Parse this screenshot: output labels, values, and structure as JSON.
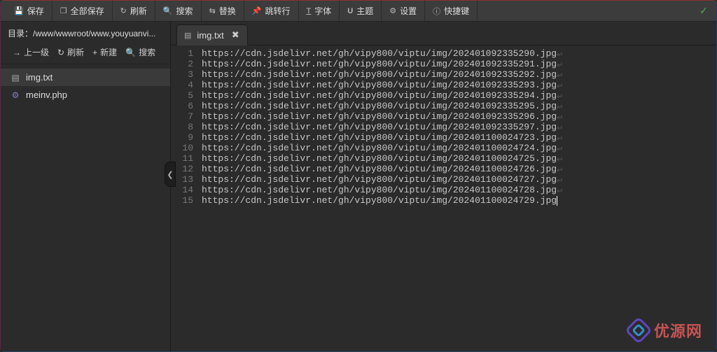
{
  "toolbar": {
    "save": "保存",
    "save_all": "全部保存",
    "refresh": "刷新",
    "search": "搜索",
    "replace": "替换",
    "goto": "跳转行",
    "font": "字体",
    "theme": "主题",
    "settings": "设置",
    "shortcuts": "快捷键"
  },
  "sidebar": {
    "dir_label": "目录：",
    "dir_path": "/www/wwwroot/www.youyuanvi...",
    "up": "上一级",
    "refresh": "刷新",
    "new": "新建",
    "search": "搜索",
    "files": [
      {
        "name": "img.txt",
        "type": "txt",
        "active": true
      },
      {
        "name": "meinv.php",
        "type": "php",
        "active": false
      }
    ]
  },
  "tab": {
    "name": "img.txt"
  },
  "editor": {
    "lines": [
      "https://cdn.jsdelivr.net/gh/vipy800/viptu/img/202401092335290.jpg",
      "https://cdn.jsdelivr.net/gh/vipy800/viptu/img/202401092335291.jpg",
      "https://cdn.jsdelivr.net/gh/vipy800/viptu/img/202401092335292.jpg",
      "https://cdn.jsdelivr.net/gh/vipy800/viptu/img/202401092335293.jpg",
      "https://cdn.jsdelivr.net/gh/vipy800/viptu/img/202401092335294.jpg",
      "https://cdn.jsdelivr.net/gh/vipy800/viptu/img/202401092335295.jpg",
      "https://cdn.jsdelivr.net/gh/vipy800/viptu/img/202401092335296.jpg",
      "https://cdn.jsdelivr.net/gh/vipy800/viptu/img/202401092335297.jpg",
      "https://cdn.jsdelivr.net/gh/vipy800/viptu/img/202401100024723.jpg",
      "https://cdn.jsdelivr.net/gh/vipy800/viptu/img/202401100024724.jpg",
      "https://cdn.jsdelivr.net/gh/vipy800/viptu/img/202401100024725.jpg",
      "https://cdn.jsdelivr.net/gh/vipy800/viptu/img/202401100024726.jpg",
      "https://cdn.jsdelivr.net/gh/vipy800/viptu/img/202401100024727.jpg",
      "https://cdn.jsdelivr.net/gh/vipy800/viptu/img/202401100024728.jpg",
      "https://cdn.jsdelivr.net/gh/vipy800/viptu/img/202401100024729.jpg"
    ]
  },
  "watermark": "优源网"
}
